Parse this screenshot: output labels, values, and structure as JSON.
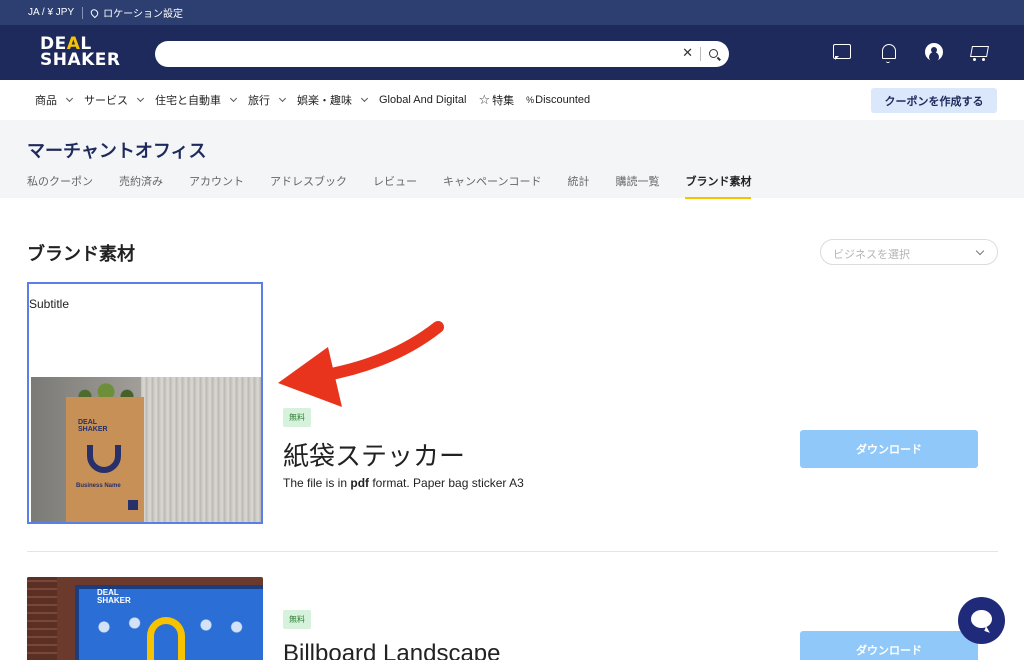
{
  "util_bar": {
    "locale": "JA / ¥ JPY",
    "location_label": "ロケーション設定"
  },
  "header": {
    "logo_line1_a": "DE",
    "logo_line1_b": "A",
    "logo_line1_c": "L",
    "logo_line2": "SHAKER",
    "search": {
      "value": "",
      "clear_glyph": "✕"
    },
    "icons": [
      "chat-icon",
      "bell-icon",
      "user-icon",
      "cart-icon"
    ]
  },
  "category_nav": {
    "items": [
      {
        "label": "商品",
        "dropdown": true
      },
      {
        "label": "サービス",
        "dropdown": true
      },
      {
        "label": "住宅と自動車",
        "dropdown": true
      },
      {
        "label": "旅行",
        "dropdown": true
      },
      {
        "label": "娯楽・趣味",
        "dropdown": true
      },
      {
        "label": "Global And Digital",
        "dropdown": false
      },
      {
        "label": "特集",
        "dropdown": false,
        "icon": "star-icon"
      },
      {
        "label": "Discounted",
        "dropdown": false,
        "icon": "percent-icon"
      }
    ],
    "create_coupon_label": "クーポンを作成する"
  },
  "office": {
    "title": "マーチャントオフィス",
    "tabs": [
      {
        "label": "私のクーポン"
      },
      {
        "label": "売約済み"
      },
      {
        "label": "アカウント"
      },
      {
        "label": "アドレスブック"
      },
      {
        "label": "レビュー"
      },
      {
        "label": "キャンペーンコード"
      },
      {
        "label": "統計"
      },
      {
        "label": "購読一覧"
      },
      {
        "label": "ブランド素材",
        "active": true
      }
    ]
  },
  "content": {
    "section_title": "ブランド素材",
    "business_select_placeholder": "ビジネスを選択",
    "products": [
      {
        "subtitle": "Subtitle",
        "badge": "無料",
        "title": "紙袋ステッカー",
        "desc_prefix": "The file is in ",
        "desc_format": "pdf",
        "desc_suffix": " format. Paper bag sticker A3",
        "download_label": "ダウンロード",
        "image_text_logo1": "DEAL",
        "image_text_logo2": "SHAKER",
        "image_text_business": "Business Name"
      },
      {
        "badge": "無料",
        "title": "Billboard Landscape",
        "download_label": "ダウンロード",
        "image_text_logo1": "DEAL",
        "image_text_logo2": "SHAKER"
      }
    ]
  },
  "colors": {
    "header_bg": "#1f2a5c",
    "util_bg": "#2d3e71",
    "accent_yellow": "#f7c300",
    "download_bg": "#90c9f9",
    "arrow_red": "#e8341c",
    "highlight_border": "#5b7fe8"
  }
}
